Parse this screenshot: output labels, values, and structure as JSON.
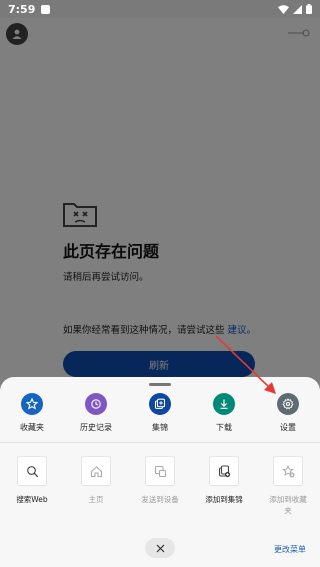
{
  "status_bar": {
    "time": "7:59"
  },
  "error_page": {
    "title": "此页存在问题",
    "line1": "请稍后再尝试访问。",
    "line2_prefix": "如果你经常看到这种情况，请尝试这些 ",
    "line2_link": "建议。",
    "refresh_label": "刷新"
  },
  "menu": {
    "primary_items": [
      {
        "label": "收藏夹",
        "icon": "star-icon",
        "color": "#1565c0"
      },
      {
        "label": "历史记录",
        "icon": "history-icon",
        "color": "#7e57c2"
      },
      {
        "label": "集锦",
        "icon": "collections-icon",
        "color": "#0d47a1"
      },
      {
        "label": "下载",
        "icon": "download-icon",
        "color": "#00897b"
      },
      {
        "label": "设置",
        "icon": "gear-icon",
        "color": "#5f6b73"
      }
    ],
    "secondary_items": [
      {
        "label": "搜索Web",
        "icon": "search-icon",
        "enabled": true
      },
      {
        "label": "主页",
        "icon": "home-icon",
        "enabled": false
      },
      {
        "label": "发送到设备",
        "icon": "send-to-device-icon",
        "enabled": false
      },
      {
        "label": "添加到集锦",
        "icon": "add-to-collection-icon",
        "enabled": true
      },
      {
        "label": "添加到收藏夹",
        "icon": "add-to-favorites-icon",
        "enabled": false
      }
    ],
    "edit_menu_label": "更改菜单"
  },
  "annotation": {
    "arrow_color": "#e53935"
  }
}
